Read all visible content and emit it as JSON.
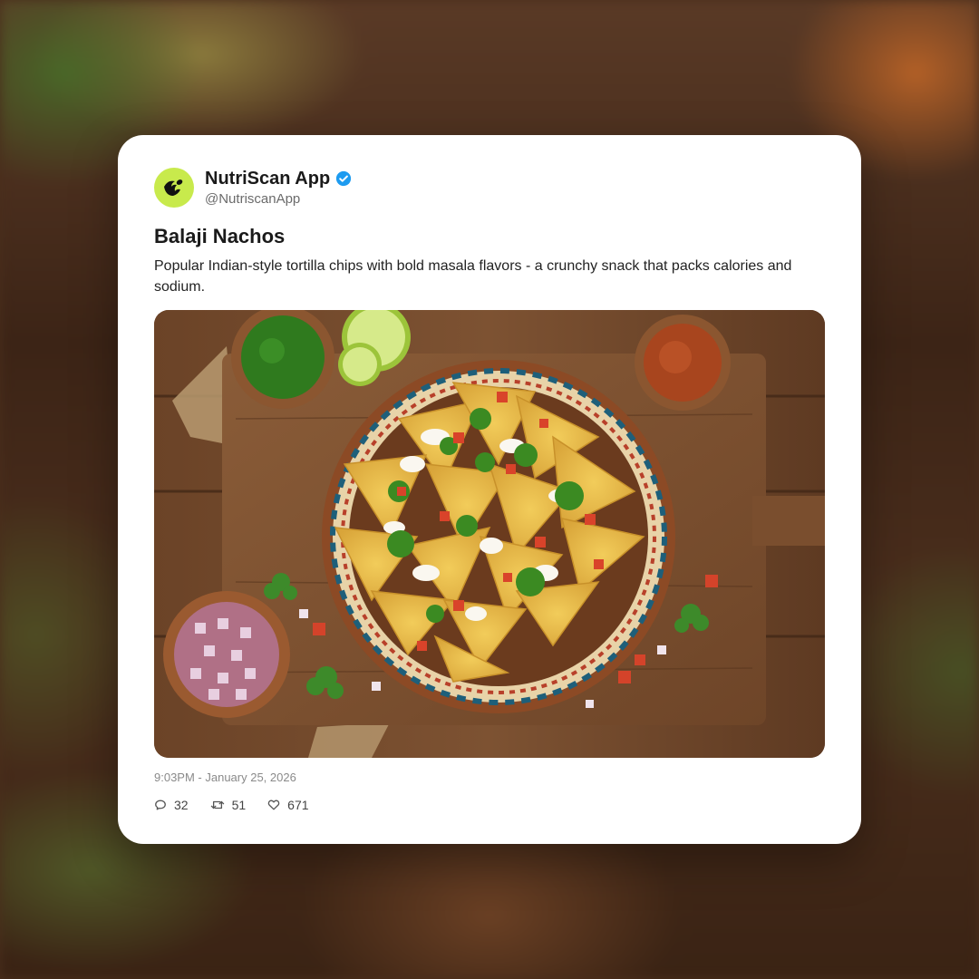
{
  "post": {
    "display_name": "NutriScan App",
    "handle": "@NutriscanApp",
    "verified": true,
    "title": "Balaji Nachos",
    "description": "Popular Indian-style tortilla chips with bold masala flavors - a crunchy snack that packs calories and sodium.",
    "image_alt_icon": "nachos-photo",
    "timestamp": "9:03PM - January 25, 2026",
    "stats": {
      "replies": "32",
      "reposts": "51",
      "likes": "671"
    }
  },
  "colors": {
    "avatar_bg": "#c8ea4c",
    "verified_blue": "#1d9bf0",
    "card_bg": "#ffffff"
  },
  "icons": {
    "avatar": "nutriscan-logo-icon",
    "verified": "verified-badge-icon",
    "reply": "reply-icon",
    "repost": "repost-icon",
    "like": "heart-icon"
  }
}
